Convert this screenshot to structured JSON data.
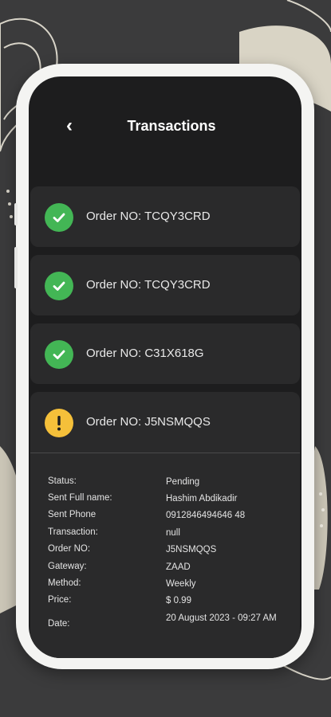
{
  "header": {
    "back_icon": "chevron-left-icon",
    "title": "Transactions"
  },
  "transactions": [
    {
      "label": "Order NO: TCQY3CRD",
      "status_icon": "check-circle-icon",
      "status_color": "#43b655"
    },
    {
      "label": "Order NO: TCQY3CRD",
      "status_icon": "check-circle-icon",
      "status_color": "#43b655"
    },
    {
      "label": "Order NO: C31X618G",
      "status_icon": "check-circle-icon",
      "status_color": "#43b655"
    },
    {
      "label": "Order NO: J5NSMQQS",
      "status_icon": "warning-circle-icon",
      "status_color": "#f5c03a"
    }
  ],
  "details": [
    {
      "key": "Status:",
      "value": "Pending"
    },
    {
      "key": "Sent Full name:",
      "value": "Hashim Abdikadir"
    },
    {
      "key": "Sent Phone",
      "value": "0912846494646 48"
    },
    {
      "key": "Transaction:",
      "value": "null"
    },
    {
      "key": "Order NO:",
      "value": "J5NSMQQS"
    },
    {
      "key": "Gateway:",
      "value": "ZAAD"
    },
    {
      "key": "Method:",
      "value": "Weekly"
    },
    {
      "key": "Price:",
      "value": "$ 0.99"
    },
    {
      "key": "Date:",
      "value": "20 August 2023 - 09:27 AM"
    }
  ],
  "colors": {
    "success": "#43b655",
    "pending": "#f5c03a",
    "card": "#2a2a2b",
    "screen": "#1d1d1e"
  }
}
